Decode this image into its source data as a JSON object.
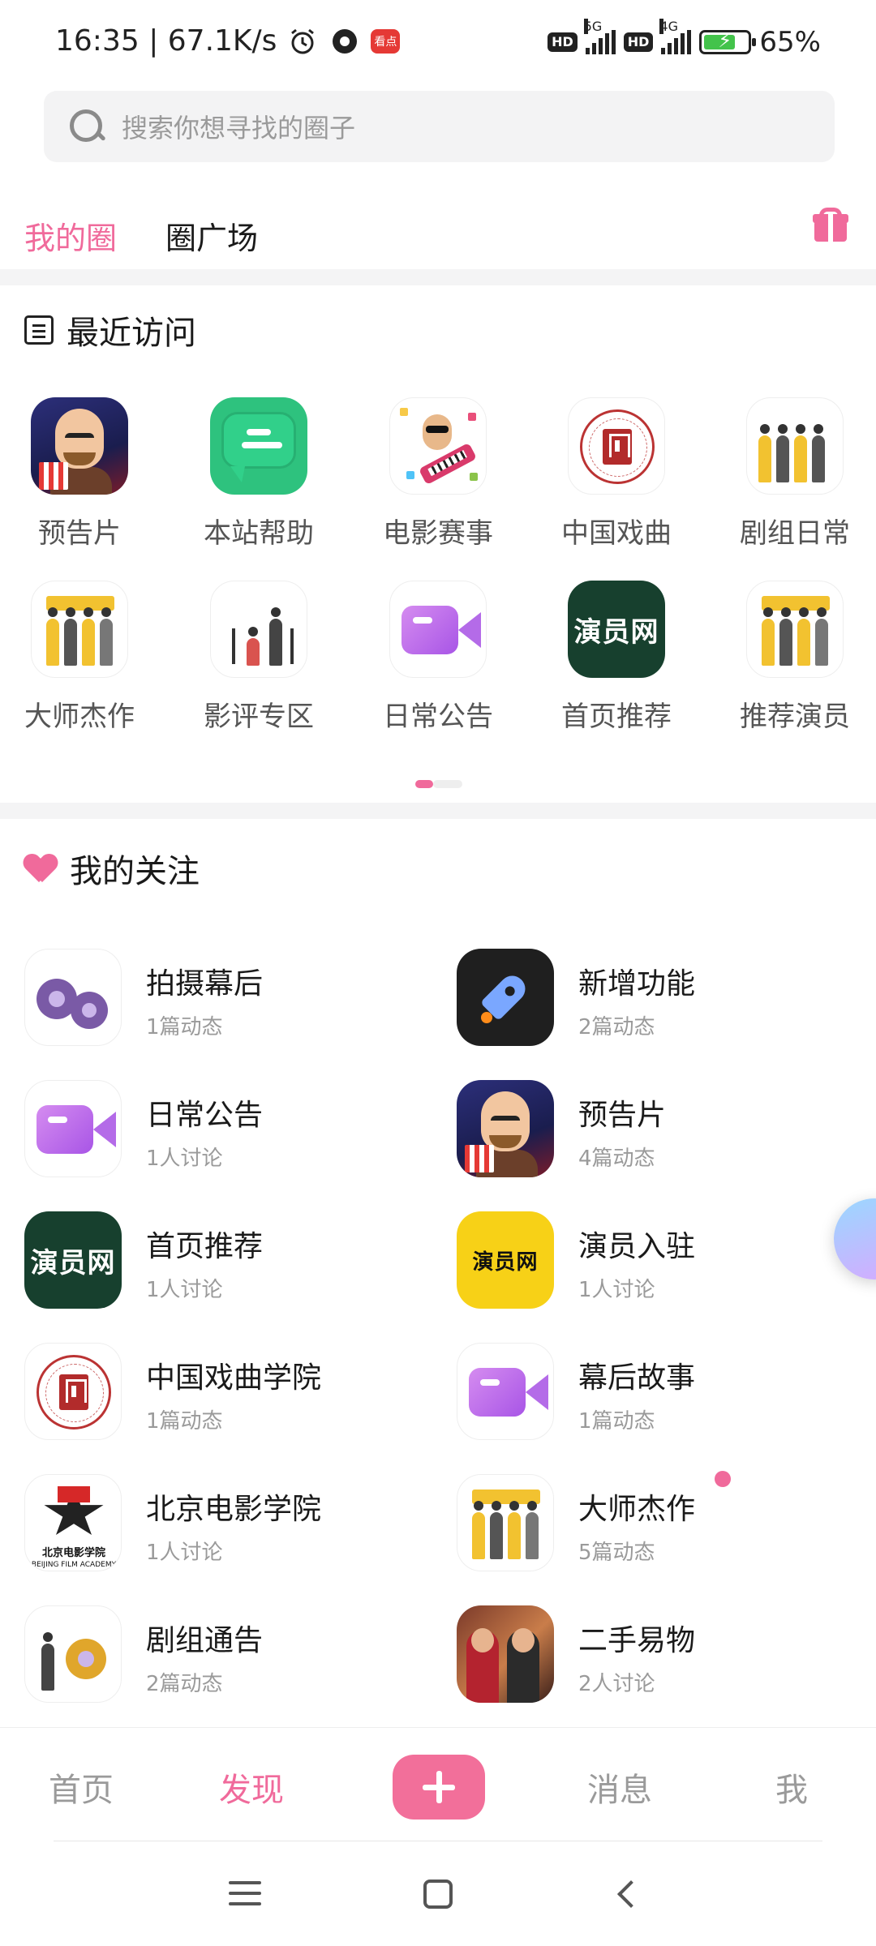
{
  "status_bar": {
    "time_speed": "16:35 | 67.1K/s",
    "hd1": "HD",
    "net1": "5G",
    "hd2": "HD",
    "net2": "4G",
    "battery": "65%",
    "icons": [
      "alarm-icon",
      "camera-icon",
      "news-app-icon"
    ]
  },
  "search": {
    "placeholder": "搜索你想寻找的圈子"
  },
  "tabs": [
    {
      "label": "我的圈",
      "active": true
    },
    {
      "label": "圈广场",
      "active": false
    }
  ],
  "recent": {
    "title": "最近访问",
    "items": [
      {
        "label": "预告片",
        "icon": "trailer"
      },
      {
        "label": "本站帮助",
        "icon": "help"
      },
      {
        "label": "电影赛事",
        "icon": "contest"
      },
      {
        "label": "中国戏曲",
        "icon": "opera"
      },
      {
        "label": "剧组日常",
        "icon": "crew"
      },
      {
        "label": "大师杰作",
        "icon": "crew"
      },
      {
        "label": "影评专区",
        "icon": "critic"
      },
      {
        "label": "日常公告",
        "icon": "video"
      },
      {
        "label": "首页推荐",
        "icon": "actor-dark"
      },
      {
        "label": "推荐演员",
        "icon": "crew"
      }
    ]
  },
  "logos": {
    "actor_dark": "演员网",
    "actor_yellow": "演员网",
    "bfa_cn": "北京电影学院",
    "bfa_en": "BEIJING FILM ACADEMY"
  },
  "following": {
    "title": "我的关注",
    "items": [
      {
        "name": "拍摄幕后",
        "meta": "1篇动态"
      },
      {
        "name": "新增功能",
        "meta": "2篇动态"
      },
      {
        "name": "日常公告",
        "meta": "1人讨论"
      },
      {
        "name": "预告片",
        "meta": "4篇动态"
      },
      {
        "name": "首页推荐",
        "meta": "1人讨论"
      },
      {
        "name": "演员入驻",
        "meta": "1人讨论"
      },
      {
        "name": "中国戏曲学院",
        "meta": "1篇动态"
      },
      {
        "name": "幕后故事",
        "meta": "1篇动态"
      },
      {
        "name": "北京电影学院",
        "meta": "1人讨论"
      },
      {
        "name": "大师杰作",
        "meta": "5篇动态",
        "unread": true
      },
      {
        "name": "剧组通告",
        "meta": "2篇动态"
      },
      {
        "name": "二手易物",
        "meta": "2人讨论"
      }
    ]
  },
  "bottom_nav": {
    "home": "首页",
    "discover": "发现",
    "messages": "消息",
    "me": "我",
    "active": "discover"
  },
  "colors": {
    "accent": "#f06a9b",
    "text_primary": "#1a1a1a",
    "text_secondary": "#9a9a9a"
  }
}
